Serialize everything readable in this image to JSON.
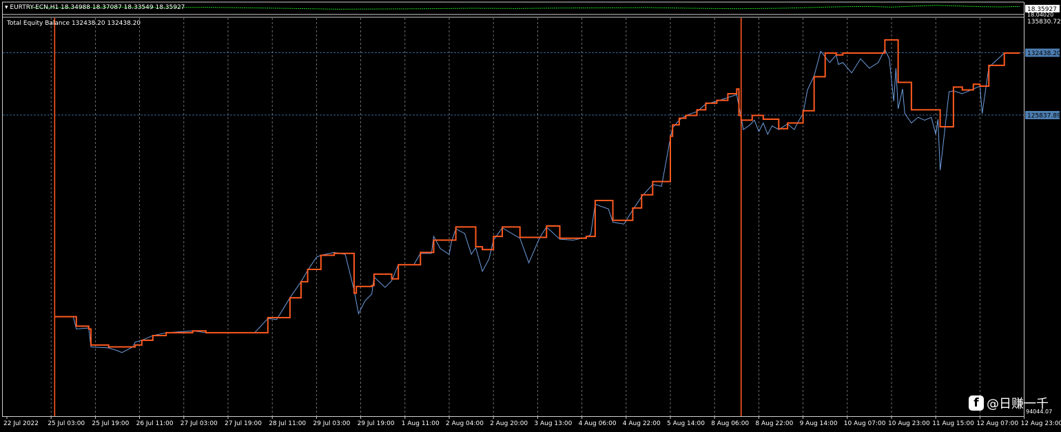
{
  "symbol_bar": {
    "label": "EURTRY-ECN,H1  18.34988 18.37087 18.33549 18.35927",
    "price_tag": "18.35927",
    "price_low": "18.04020"
  },
  "indicator": {
    "label": "Total Equity Balance 132438.20 132438.20"
  },
  "colors": {
    "background": "#000000",
    "balance": "#ff5a1f",
    "equity": "#6f9fe0",
    "grid": "#8a8a8a",
    "price": "#1fdc1f",
    "level_line": "#4a86c8"
  },
  "chart_data": {
    "type": "line",
    "title": "",
    "xlabel": "",
    "ylabel": "",
    "ylim": [
      94044.07,
      135830.72
    ],
    "y_axis_labels": [
      "135830.72",
      "94044.07"
    ],
    "x_ticks": [
      "22 Jul 2022",
      "25 Jul 03:00",
      "25 Jul 19:00",
      "26 Jul 11:00",
      "27 Jul 03:00",
      "27 Jul 19:00",
      "28 Jul 11:00",
      "29 Jul 03:00",
      "29 Jul 19:00",
      "1 Aug 11:00",
      "2 Aug 04:00",
      "2 Aug 20:00",
      "3 Aug 13:00",
      "4 Aug 06:00",
      "4 Aug 22:00",
      "5 Aug 14:00",
      "8 Aug 06:00",
      "8 Aug 22:00",
      "9 Aug 14:00",
      "10 Aug 07:00",
      "10 Aug 23:00",
      "11 Aug 15:00",
      "12 Aug 07:00",
      "12 Aug 23:00"
    ],
    "levels": [
      {
        "value": 132438.2,
        "label": "132438.20"
      },
      {
        "value": 125837.89,
        "label": "125837.89"
      }
    ],
    "markers": [
      1.08,
      16.6
    ],
    "series": [
      {
        "name": "Balance",
        "x": [
          1.08,
          1.5,
          1.57,
          1.85,
          1.9,
          2.3,
          2.6,
          2.9,
          3.05,
          3.3,
          3.6,
          4.2,
          4.5,
          5.2,
          5.6,
          5.9,
          6.1,
          6.4,
          6.65,
          6.8,
          7.1,
          7.4,
          7.65,
          7.85,
          7.9,
          8.25,
          8.3,
          8.7,
          8.85,
          9.2,
          9.35,
          9.6,
          9.65,
          10.05,
          10.15,
          10.35,
          10.6,
          10.75,
          11.0,
          11.2,
          11.6,
          11.8,
          12.05,
          12.2,
          12.5,
          12.8,
          13.1,
          13.3,
          13.6,
          13.7,
          13.95,
          14.15,
          14.35,
          14.6,
          14.8,
          15.0,
          15.05,
          15.2,
          15.35,
          15.6,
          15.8,
          16.05,
          16.3,
          16.5,
          16.55,
          16.6,
          16.65,
          16.85,
          17.1,
          17.3,
          17.45,
          17.65,
          17.9,
          18.0,
          18.25,
          18.5,
          18.75,
          18.9,
          19.3,
          19.7,
          19.85,
          20.05,
          20.15,
          20.3,
          20.45,
          20.9,
          21.0,
          21.1,
          21.4,
          21.6,
          21.85,
          22.0,
          22.2,
          22.55,
          22.9
        ],
        "values": [
          104500,
          104500,
          103500,
          103200,
          101500,
          101300,
          101300,
          101500,
          102000,
          102500,
          102800,
          103000,
          102800,
          102800,
          102800,
          104400,
          104400,
          106500,
          108200,
          109500,
          111000,
          111200,
          111200,
          107000,
          107700,
          107800,
          109000,
          108500,
          110000,
          110000,
          111300,
          111300,
          112600,
          112600,
          114000,
          114000,
          111900,
          111600,
          113000,
          114000,
          112900,
          112900,
          112900,
          114100,
          112800,
          112800,
          113000,
          116800,
          116800,
          114700,
          114700,
          116000,
          117400,
          118800,
          118800,
          123600,
          124800,
          125500,
          125800,
          126400,
          127100,
          127400,
          128100,
          128600,
          125800,
          125300,
          125300,
          125800,
          125400,
          125400,
          124400,
          125000,
          125000,
          126300,
          129900,
          132400,
          132200,
          132400,
          132400,
          132400,
          133800,
          133800,
          129300,
          129300,
          126400,
          126400,
          126400,
          124600,
          128800,
          128500,
          129100,
          128900,
          131100,
          132400,
          132400
        ]
      },
      {
        "name": "Equity",
        "x": [
          1.08,
          1.5,
          1.57,
          1.85,
          1.9,
          2.3,
          2.5,
          2.6,
          2.85,
          2.9,
          3.05,
          3.3,
          3.6,
          4.2,
          4.5,
          5.2,
          5.6,
          5.9,
          6.1,
          6.4,
          6.65,
          6.8,
          7.0,
          7.1,
          7.4,
          7.65,
          7.85,
          7.95,
          8.1,
          8.25,
          8.3,
          8.55,
          8.7,
          8.85,
          9.2,
          9.35,
          9.6,
          9.65,
          9.8,
          10.0,
          10.05,
          10.15,
          10.35,
          10.5,
          10.6,
          10.75,
          10.9,
          11.0,
          11.2,
          11.6,
          11.8,
          12.05,
          12.2,
          12.5,
          12.8,
          13.1,
          13.2,
          13.3,
          13.6,
          13.7,
          13.95,
          14.15,
          14.35,
          14.6,
          14.8,
          15.0,
          15.05,
          15.2,
          15.35,
          15.6,
          15.8,
          16.05,
          16.3,
          16.5,
          16.6,
          16.65,
          16.8,
          16.9,
          17.0,
          17.1,
          17.2,
          17.3,
          17.45,
          17.65,
          17.8,
          17.9,
          18.0,
          18.1,
          18.25,
          18.4,
          18.5,
          18.6,
          18.75,
          18.8,
          18.9,
          19.1,
          19.3,
          19.5,
          19.7,
          19.85,
          19.95,
          20.05,
          20.1,
          20.15,
          20.25,
          20.3,
          20.45,
          20.6,
          20.75,
          20.9,
          21.0,
          21.05,
          21.1,
          21.15,
          21.3,
          21.4,
          21.6,
          21.85,
          22.0,
          22.05,
          22.2,
          22.55,
          22.9
        ],
        "values": [
          104500,
          104500,
          103200,
          103300,
          101300,
          101200,
          100900,
          100700,
          101300,
          101800,
          102000,
          102500,
          102800,
          103000,
          102800,
          102800,
          102800,
          104300,
          104200,
          106500,
          108200,
          109400,
          110800,
          111000,
          111300,
          111100,
          107300,
          104800,
          106200,
          106900,
          108700,
          107600,
          108300,
          110000,
          110000,
          111200,
          111200,
          113000,
          111700,
          111100,
          112400,
          113800,
          113300,
          111100,
          111800,
          109300,
          110600,
          112600,
          113900,
          112800,
          110200,
          112900,
          114000,
          112700,
          112600,
          112900,
          113200,
          116400,
          115900,
          114500,
          114300,
          115800,
          117200,
          118500,
          118300,
          123400,
          124500,
          125300,
          125800,
          126200,
          127000,
          127300,
          127700,
          128000,
          125600,
          124300,
          124800,
          125300,
          124100,
          125000,
          123800,
          124700,
          124300,
          124900,
          124300,
          125200,
          126000,
          128500,
          130000,
          132600,
          132000,
          131400,
          132200,
          131200,
          131400,
          130300,
          131800,
          130800,
          131400,
          132800,
          131800,
          127300,
          130800,
          126500,
          128600,
          126000,
          125000,
          125600,
          125300,
          125600,
          123800,
          125400,
          120000,
          122000,
          128300,
          128400,
          128100,
          128600,
          128900,
          126000,
          130900,
          132400,
          132400
        ]
      },
      {
        "name": "EURTRY-ECN,H1",
        "x": [
          0.5,
          1.5,
          2.5,
          3.5,
          4.5,
          5.5,
          6.5,
          7.5,
          8.5,
          9.5,
          10.5,
          11.5,
          12.5,
          13.5,
          14.5,
          15.5,
          16.5,
          17.5,
          18.5,
          19.0,
          19.5,
          20.0,
          20.5,
          21.0,
          21.5,
          22.0,
          22.5,
          22.9
        ],
        "values": [
          18.3,
          18.31,
          18.33,
          18.31,
          18.32,
          18.3,
          18.27,
          18.24,
          18.25,
          18.26,
          18.28,
          18.27,
          18.29,
          18.3,
          18.31,
          18.28,
          18.26,
          18.28,
          18.33,
          18.35,
          18.36,
          18.33,
          18.37,
          18.41,
          18.38,
          18.35,
          18.34,
          18.36
        ]
      }
    ]
  },
  "price_chart": {
    "ylim": [
      18.0402,
      18.43
    ]
  },
  "watermark": {
    "icon": "facebook-icon",
    "glyph": "f",
    "text": "@日赚一千"
  }
}
